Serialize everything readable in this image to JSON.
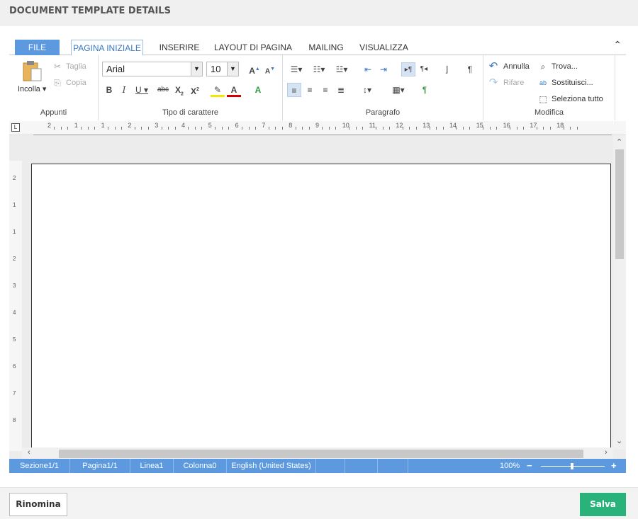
{
  "window": {
    "title": "DOCUMENT TEMPLATE DETAILS"
  },
  "tabs": [
    {
      "label": "FILE"
    },
    {
      "label": "PAGINA INIZIALE"
    },
    {
      "label": "INSERIRE"
    },
    {
      "label": "LAYOUT DI PAGINA"
    },
    {
      "label": "MAILING"
    },
    {
      "label": "VISUALIZZA"
    }
  ],
  "ribbon": {
    "appunti": {
      "label": "Appunti",
      "paste": "Incolla ▾",
      "cut": "Taglia",
      "copy": "Copia"
    },
    "font": {
      "label": "Tipo di carattere",
      "family": "Arial",
      "size": "10"
    },
    "paragraph": {
      "label": "Paragrafo"
    },
    "modifica": {
      "label": "Modifica",
      "undo": "Annulla",
      "redo": "Rifare",
      "find": "Trova...",
      "replace": "Sostituisci...",
      "select_all": "Seleziona tutto"
    }
  },
  "ruler": {
    "h_numbers": [
      "2",
      "1",
      "1",
      "2",
      "3",
      "4",
      "5",
      "6",
      "7",
      "8",
      "9",
      "10",
      "11",
      "12",
      "13",
      "14",
      "15",
      "16",
      "17",
      "18"
    ],
    "v_numbers": [
      "2",
      "1",
      "1",
      "2",
      "3",
      "4",
      "5",
      "6",
      "7",
      "8"
    ]
  },
  "status": {
    "section": "Sezione1/1",
    "page": "Pagina1/1",
    "line": "Linea1",
    "column": "Colonna0",
    "language": "English (United States)",
    "zoom": "100%"
  },
  "footer": {
    "rename": "Rinomina",
    "save": "Salva"
  },
  "colors": {
    "accent": "#5c99de",
    "save": "#2ab27b"
  }
}
